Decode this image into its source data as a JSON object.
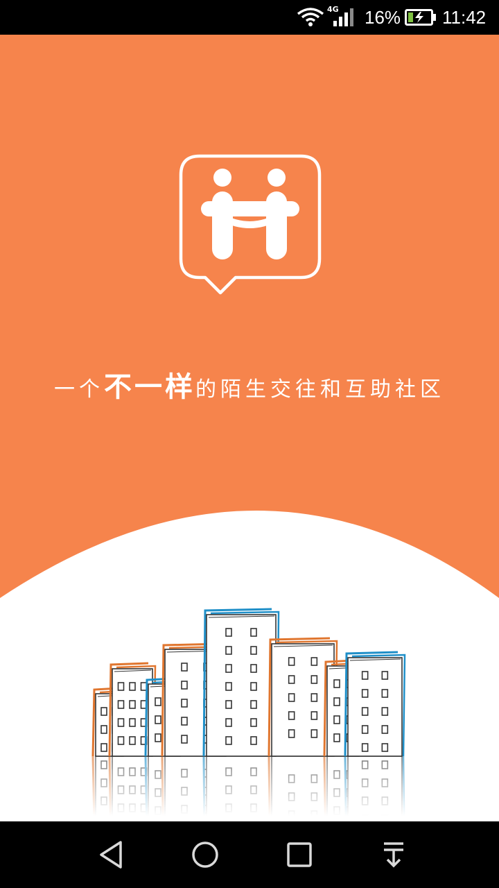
{
  "status_bar": {
    "network_type": "4G",
    "battery_percent": "16%",
    "time": "11:42",
    "icons": [
      "wifi-icon",
      "signal-icon",
      "battery-charging-icon"
    ]
  },
  "splash": {
    "tagline_parts": [
      "一个",
      "不一样",
      "的陌生交往和互助社区"
    ],
    "colors": {
      "brand_orange": "#F6844C",
      "logo_white": "#FFFFFF",
      "building_orange": "#E0762F",
      "building_blue": "#1F8FC8",
      "building_outline": "#333333"
    }
  },
  "nav_bar": {
    "buttons": [
      "back-icon",
      "home-icon",
      "recents-icon",
      "notification-pull-icon"
    ]
  }
}
